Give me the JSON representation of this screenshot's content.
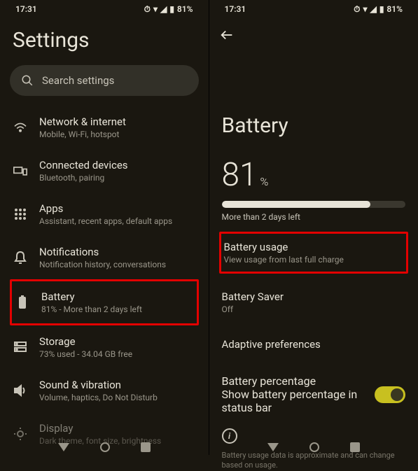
{
  "status": {
    "time": "17:31",
    "batt": "81%"
  },
  "left": {
    "title": "Settings",
    "search_placeholder": "Search settings",
    "items": [
      {
        "title": "Network & internet",
        "sub": "Mobile, Wi-Fi, hotspot"
      },
      {
        "title": "Connected devices",
        "sub": "Bluetooth, pairing"
      },
      {
        "title": "Apps",
        "sub": "Assistant, recent apps, default apps"
      },
      {
        "title": "Notifications",
        "sub": "Notification history, conversations"
      },
      {
        "title": "Battery",
        "sub": "81% - More than 2 days left"
      },
      {
        "title": "Storage",
        "sub": "73% used - 34.04 GB free"
      },
      {
        "title": "Sound & vibration",
        "sub": "Volume, haptics, Do Not Disturb"
      },
      {
        "title": "Display",
        "sub": "Dark theme, font size, brightness"
      }
    ]
  },
  "right": {
    "title": "Battery",
    "percent": "81",
    "percent_sym": "%",
    "est": "More than 2 days left",
    "items": [
      {
        "title": "Battery usage",
        "sub": "View usage from last full charge"
      },
      {
        "title": "Battery Saver",
        "sub": "Off"
      },
      {
        "title": "Adaptive preferences",
        "sub": ""
      },
      {
        "title": "Battery percentage",
        "sub": "Show battery percentage in status bar"
      }
    ],
    "foot": "Battery usage data is approximate and can change based on usage."
  }
}
